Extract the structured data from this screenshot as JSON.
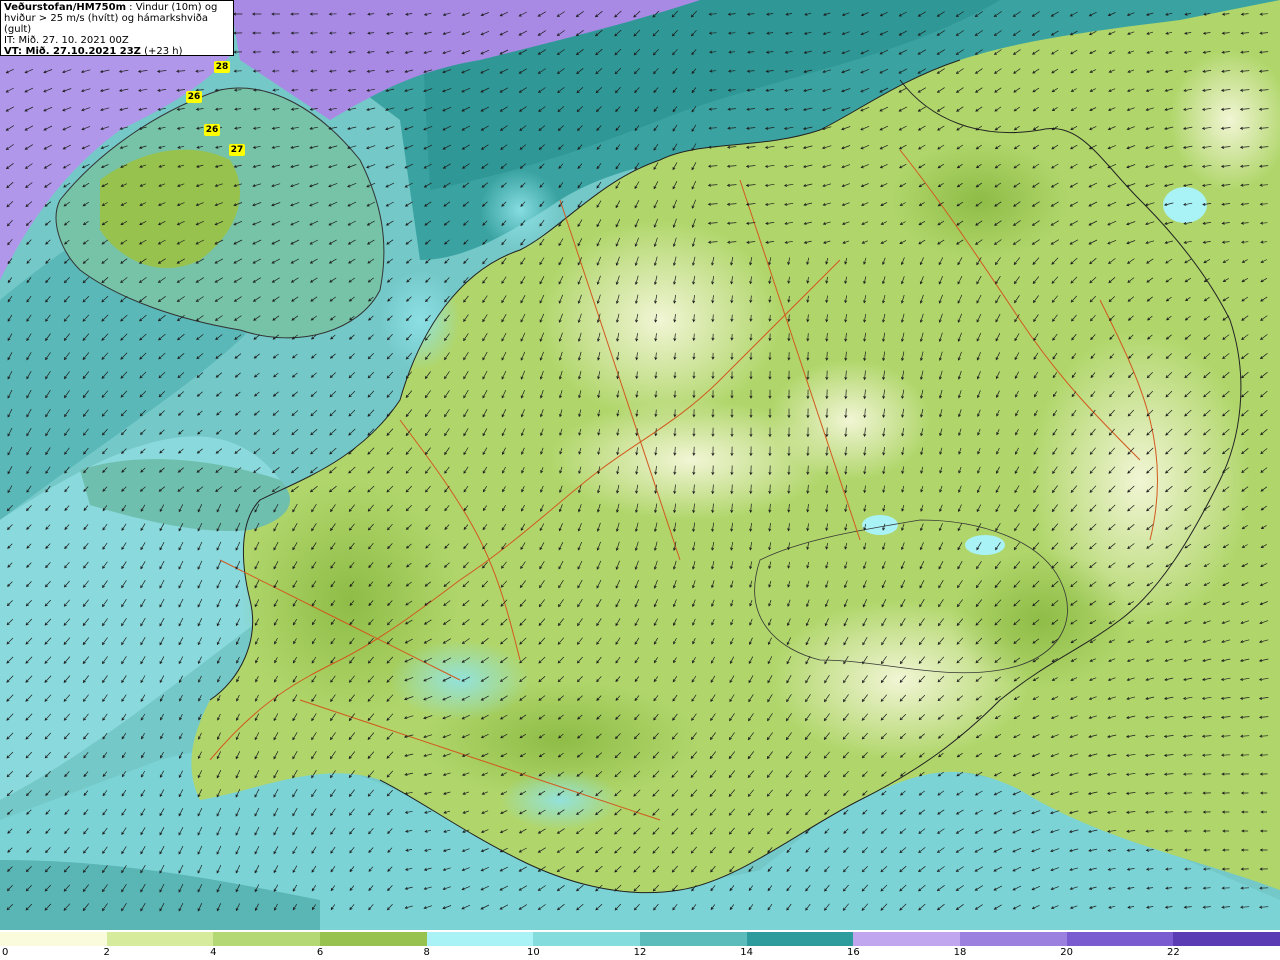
{
  "header": {
    "title": "Veðurstofan/HM750m",
    "title_suffix": " : Vindur (10m) og",
    "line2": "hviður > 25 m/s (hvítt) og hámarkshviða (gult)",
    "line3": "IT: Mið. 27. 10. 2021 00Z",
    "line4": "VT: Mið. 27.10.2021 23Z",
    "line4_suffix": " (+23 h)"
  },
  "gust_labels": [
    "28",
    "26",
    "26",
    "27"
  ],
  "legend": {
    "ticks": [
      "0",
      "2",
      "4",
      "6",
      "8",
      "10",
      "12",
      "14",
      "16",
      "18",
      "20",
      "22"
    ],
    "colors": [
      "#fafadc",
      "#d6eb9c",
      "#b4d873",
      "#97c24d",
      "#a9f3f6",
      "#84dcdc",
      "#5cbcbc",
      "#2e9c9c",
      "#c0a6ee",
      "#9c80e0",
      "#7a5cd0",
      "#5c3cb4"
    ]
  },
  "colors": {
    "ocean_shallow": "#7fd0d0",
    "ocean_deep": "#3da5a3",
    "sea_purple": "#a98de6",
    "land_calm": "#f2f5d0",
    "land_light": "#cfe59a",
    "land_mid": "#a9d06c",
    "land_strong": "#8fbd48",
    "roads": "#d2581e",
    "coastline": "#222222",
    "arrows": "#1c1c1c",
    "gust_label": "#ffff00"
  }
}
